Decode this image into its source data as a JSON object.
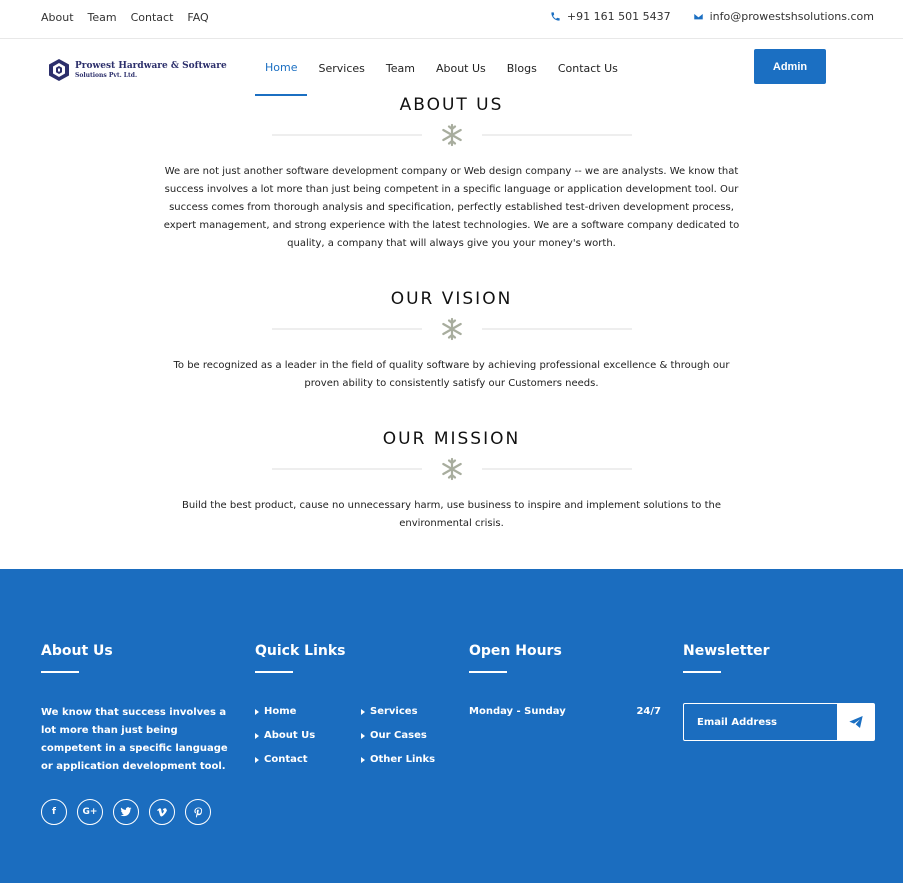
{
  "topbar": {
    "links": [
      "About",
      "Team",
      "Contact",
      "FAQ"
    ],
    "phone": "+91 161 501 5437",
    "email": "info@prowestshsolutions.com"
  },
  "brand": {
    "name": "Prowest Hardware & Software",
    "sub": "Solutions Pvt. Ltd.",
    "color": "#2c2f6b"
  },
  "nav": {
    "items": [
      "Home",
      "Services",
      "Team",
      "About Us",
      "Blogs",
      "Contact Us"
    ],
    "active": "Home",
    "admin_label": "Admin"
  },
  "sections": [
    {
      "title": "ABOUT US",
      "text": "We are not just another software development company or Web design company -- we are analysts. We know that success involves a lot more than just being competent in a specific language or application development tool. Our success comes from thorough analysis and specification, perfectly established test-driven development process, expert management, and strong experience with the latest technologies. We are a software company dedicated to quality, a company that will always give you your money's worth."
    },
    {
      "title": "OUR VISION",
      "text": "To be recognized as a leader in the field of quality software by achieving professional excellence & through our proven ability to consistently satisfy our Customers needs."
    },
    {
      "title": "OUR MISSION",
      "text": "Build the best product, cause no unnecessary harm, use business to inspire and implement solutions to the environmental crisis."
    }
  ],
  "footer": {
    "about": {
      "title": "About Us",
      "text": "We know that success involves a lot more than just being competent in a specific language or application development tool."
    },
    "quick_links": {
      "title": "Quick Links",
      "items": [
        "Home",
        "Services",
        "About Us",
        "Our Cases",
        "Contact",
        "Other Links"
      ]
    },
    "hours": {
      "title": "Open Hours",
      "days": "Monday - Sunday",
      "time": "24/7"
    },
    "newsletter": {
      "title": "Newsletter",
      "placeholder": "Email Address"
    },
    "socials": [
      "facebook-icon",
      "google-plus-icon",
      "twitter-icon",
      "vimeo-icon",
      "pinterest-icon"
    ]
  },
  "colors": {
    "accent": "#1b6fc2",
    "footer_bg": "#1b6dbf",
    "snowflake": "#a8ad9e"
  }
}
